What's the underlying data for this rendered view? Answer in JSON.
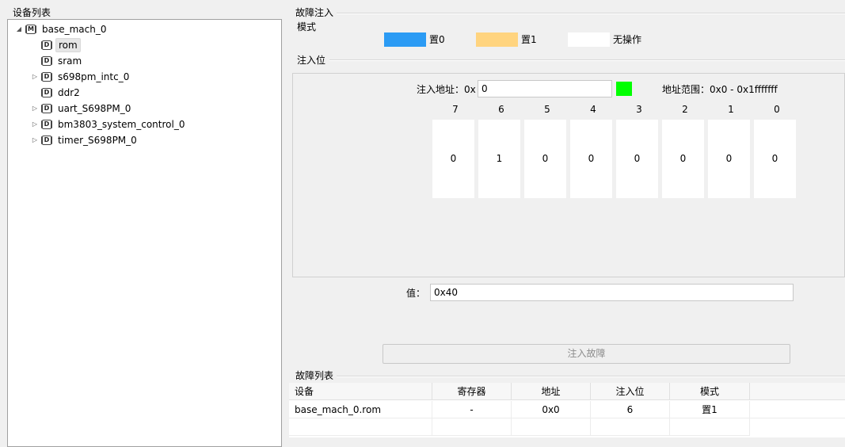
{
  "device_list": {
    "title": "设备列表",
    "root": {
      "label": "base_mach_0",
      "icon": "M",
      "expanded": true
    },
    "items": [
      {
        "label": "rom",
        "icon": "D",
        "expandable": false,
        "selected": true
      },
      {
        "label": "sram",
        "icon": "D",
        "expandable": false,
        "selected": false
      },
      {
        "label": "s698pm_intc_0",
        "icon": "D",
        "expandable": true,
        "selected": false
      },
      {
        "label": "ddr2",
        "icon": "D",
        "expandable": false,
        "selected": false
      },
      {
        "label": "uart_S698PM_0",
        "icon": "D",
        "expandable": true,
        "selected": false
      },
      {
        "label": "bm3803_system_control_0",
        "icon": "D",
        "expandable": true,
        "selected": false
      },
      {
        "label": "timer_S698PM_0",
        "icon": "D",
        "expandable": true,
        "selected": false
      }
    ]
  },
  "fault_injection": {
    "title": "故障注入",
    "mode_title": "模式",
    "legend": [
      {
        "label": "置0",
        "color": "#2b9bf4"
      },
      {
        "label": "置1",
        "color": "#ffd47f"
      },
      {
        "label": "无操作",
        "color": "#ffffff"
      }
    ],
    "bits_title": "注入位",
    "address_label": "注入地址：0x",
    "address_value": "0",
    "address_status_color": "#00ff00",
    "address_range": "地址范围：0x0 - 0x1fffffff",
    "bits": [
      {
        "label": "7",
        "value": "0"
      },
      {
        "label": "6",
        "value": "1"
      },
      {
        "label": "5",
        "value": "0"
      },
      {
        "label": "4",
        "value": "0"
      },
      {
        "label": "3",
        "value": "0"
      },
      {
        "label": "2",
        "value": "0"
      },
      {
        "label": "1",
        "value": "0"
      },
      {
        "label": "0",
        "value": "0"
      }
    ],
    "value_label": "值：",
    "value": "0x40",
    "inject_button": "注入故障"
  },
  "fault_list": {
    "title": "故障列表",
    "columns": [
      "设备",
      "寄存器",
      "地址",
      "注入位",
      "模式"
    ],
    "rows": [
      [
        "base_mach_0.rom",
        "-",
        "0x0",
        "6",
        "置1"
      ]
    ]
  }
}
